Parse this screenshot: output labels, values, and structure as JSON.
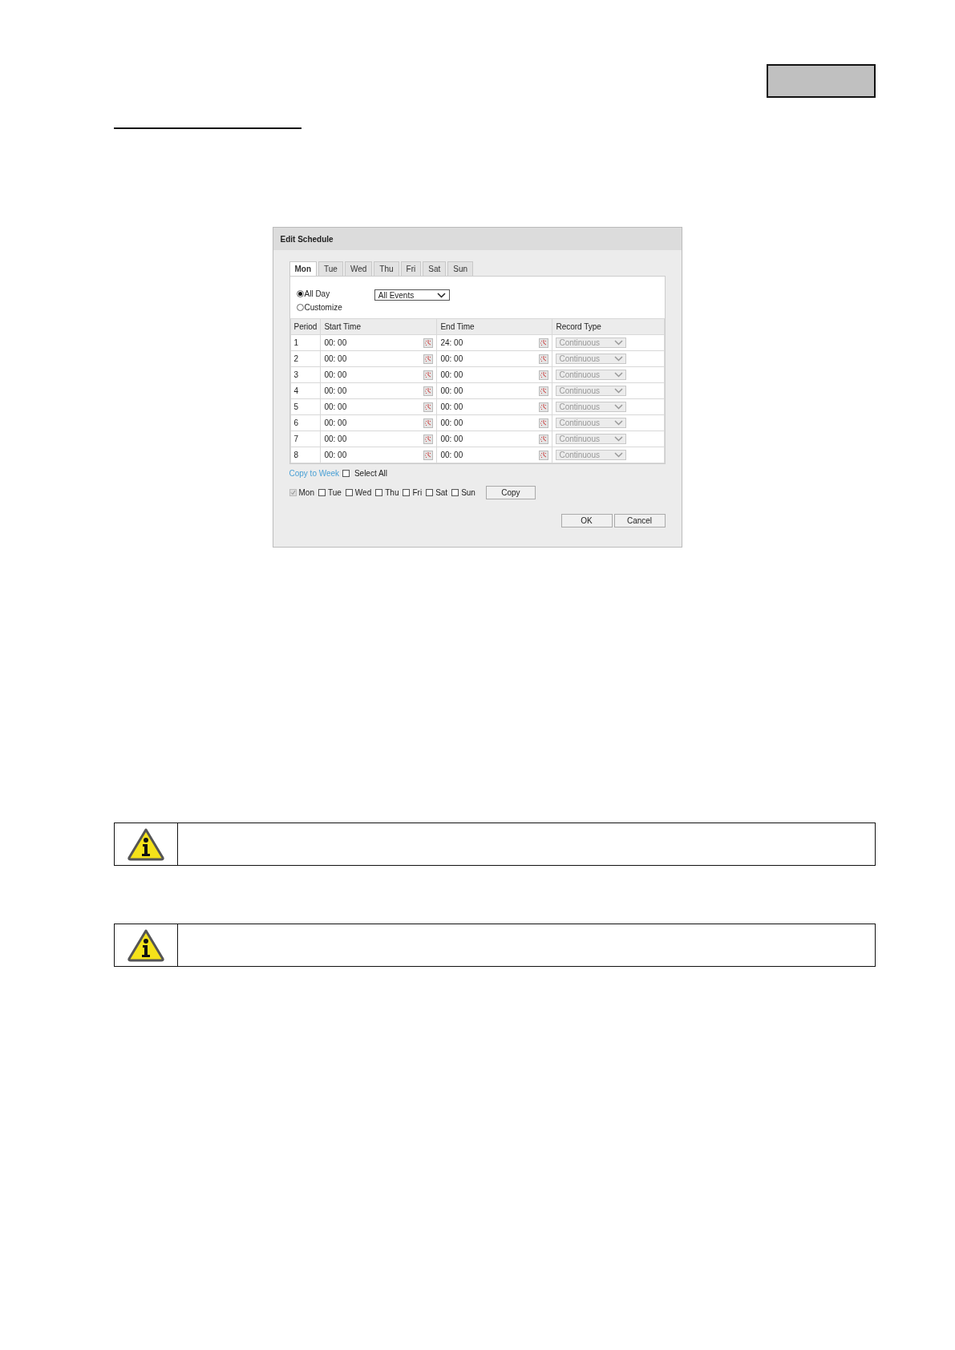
{
  "page": {
    "notices": [
      {
        "kind": "info"
      },
      {
        "kind": "info"
      }
    ]
  },
  "dialog": {
    "title": "Edit Schedule",
    "tabs": [
      {
        "label": "Mon",
        "selected": true
      },
      {
        "label": "Tue",
        "selected": false
      },
      {
        "label": "Wed",
        "selected": false
      },
      {
        "label": "Thu",
        "selected": false
      },
      {
        "label": "Fri",
        "selected": false
      },
      {
        "label": "Sat",
        "selected": false
      },
      {
        "label": "Sun",
        "selected": false
      }
    ],
    "mode_options": [
      {
        "label": "All Day",
        "selected": true
      },
      {
        "label": "Customize",
        "selected": false
      }
    ],
    "event_select": {
      "value": "All Events"
    },
    "table": {
      "columns": [
        "Period",
        "Start Time",
        "End Time",
        "Record Type"
      ],
      "rows": [
        {
          "period": "1",
          "start_time": "00: 00",
          "end_time": "24: 00",
          "record_type": "Continuous",
          "disabled": true
        },
        {
          "period": "2",
          "start_time": "00: 00",
          "end_time": "00: 00",
          "record_type": "Continuous",
          "disabled": true
        },
        {
          "period": "3",
          "start_time": "00: 00",
          "end_time": "00: 00",
          "record_type": "Continuous",
          "disabled": true
        },
        {
          "period": "4",
          "start_time": "00: 00",
          "end_time": "00: 00",
          "record_type": "Continuous",
          "disabled": true
        },
        {
          "period": "5",
          "start_time": "00: 00",
          "end_time": "00: 00",
          "record_type": "Continuous",
          "disabled": true
        },
        {
          "period": "6",
          "start_time": "00: 00",
          "end_time": "00: 00",
          "record_type": "Continuous",
          "disabled": true
        },
        {
          "period": "7",
          "start_time": "00: 00",
          "end_time": "00: 00",
          "record_type": "Continuous",
          "disabled": true
        },
        {
          "period": "8",
          "start_time": "00: 00",
          "end_time": "00: 00",
          "record_type": "Continuous",
          "disabled": true
        }
      ]
    },
    "copy_to_week": {
      "label": "Copy to Week",
      "select_all": {
        "label": "Select All",
        "checked": false
      },
      "days": [
        {
          "label": "Mon",
          "checked": true,
          "disabled": true
        },
        {
          "label": "Tue",
          "checked": false,
          "disabled": false
        },
        {
          "label": "Wed",
          "checked": false,
          "disabled": false
        },
        {
          "label": "Thu",
          "checked": false,
          "disabled": false
        },
        {
          "label": "Fri",
          "checked": false,
          "disabled": false
        },
        {
          "label": "Sat",
          "checked": false,
          "disabled": false
        },
        {
          "label": "Sun",
          "checked": false,
          "disabled": false
        }
      ],
      "copy_button": "Copy"
    },
    "buttons": [
      "OK",
      "Cancel"
    ]
  }
}
